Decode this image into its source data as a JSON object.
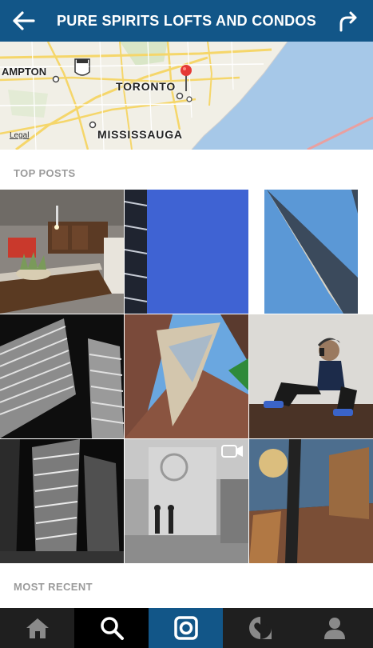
{
  "header": {
    "title": "PURE SPIRITS LOFTS AND CONDOS",
    "back_icon": "arrow-left-icon",
    "share_icon": "share-arrow-icon",
    "background": "#125688"
  },
  "map": {
    "labels": {
      "hampton": "AMPTON",
      "toronto": "TORONTO",
      "mississauga": "MISSISSAUGA",
      "highway": "407"
    },
    "legal": "Legal",
    "pin_color": "#e53935"
  },
  "sections": {
    "top_posts": "TOP POSTS",
    "most_recent": "MOST RECENT"
  },
  "posts": [
    {
      "name": "kitchen-interior-photo"
    },
    {
      "name": "condo-balconies-sky-photo"
    },
    {
      "name": "tower-corner-sky-photo"
    },
    {
      "name": "bw-condo-towers-photo"
    },
    {
      "name": "brick-building-upward-photo"
    },
    {
      "name": "woman-sitting-selfie-photo"
    },
    {
      "name": "bw-tower-night-photo"
    },
    {
      "name": "musicians-street-video",
      "video": true
    },
    {
      "name": "reflection-street-photo"
    }
  ],
  "tabbar": {
    "tabs": [
      "home-icon",
      "search-icon",
      "camera-icon",
      "activity-heart-icon",
      "profile-icon"
    ],
    "active": "search-icon"
  }
}
